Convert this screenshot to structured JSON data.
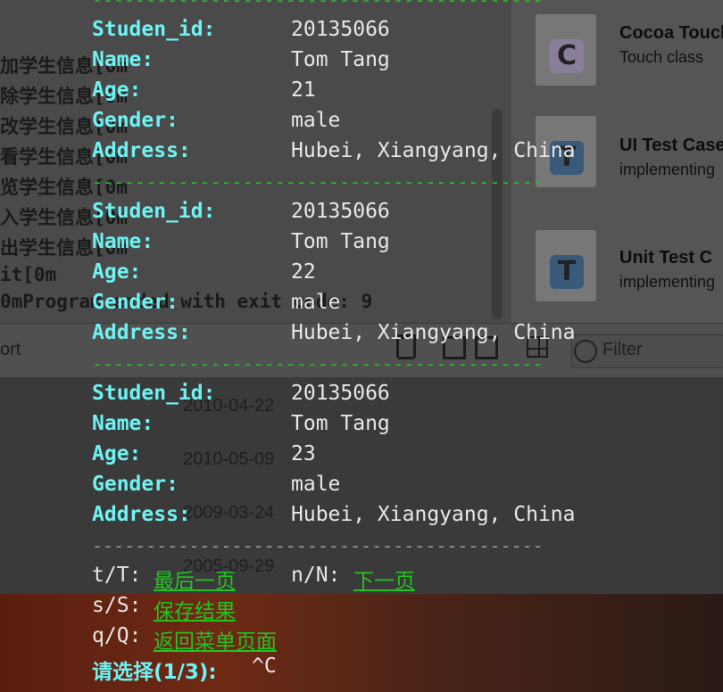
{
  "background_terminal": {
    "lines": [
      "加学生信息[0m",
      "除学生信息[0m",
      "改学生信息[0m",
      "看学生信息[0m",
      "览学生信息[0m",
      "入学生信息[0m",
      "出学生信息[0m",
      "it[0m",
      "0mProgram ended with exit code: 9"
    ]
  },
  "xcode_panel": {
    "templates": [
      {
        "title": "Cocoa Touch",
        "subtitle": "Touch class",
        "glyph": "C",
        "icon": "cocoa-class-icon"
      },
      {
        "title": "UI Test Case",
        "subtitle": "implementing",
        "glyph": "T",
        "icon": "ui-test-icon"
      },
      {
        "title": "Unit Test C",
        "subtitle": "implementing",
        "glyph": "T",
        "icon": "unit-test-icon"
      }
    ],
    "sort_label": "ort",
    "filter_placeholder": "Filter",
    "dates": [
      "2010-04-22",
      "2010-05-09",
      "2009-03-24",
      "2005-09-29"
    ]
  },
  "terminal": {
    "separator": "------------------------------------------",
    "labels": {
      "id": "Studen_id:",
      "name": "Name:",
      "age": "Age:",
      "gender": "Gender:",
      "address": "Address:"
    },
    "records": [
      {
        "id": "20135066",
        "name": "Tom Tang",
        "age": "21",
        "gender": "male",
        "address": "Hubei, Xiangyang, China"
      },
      {
        "id": "20135066",
        "name": "Tom Tang",
        "age": "22",
        "gender": "male",
        "address": "Hubei, Xiangyang, China"
      },
      {
        "id": "20135066",
        "name": "Tom Tang",
        "age": "23",
        "gender": "male",
        "address": "Hubei, Xiangyang, China"
      }
    ],
    "menu": {
      "t_key": "t/T:",
      "t_label": "最后一页",
      "n_key": "n/N:",
      "n_label": "下一页",
      "s_key": "s/S:",
      "s_label": "保存结果",
      "q_key": "q/Q:",
      "q_label": "返回菜单页面"
    },
    "prompt": "请选择(1/3):",
    "input": "^C"
  },
  "colors": {
    "separator": "#22c322",
    "label": "#6ff2f2",
    "value": "#e8e8e8"
  }
}
